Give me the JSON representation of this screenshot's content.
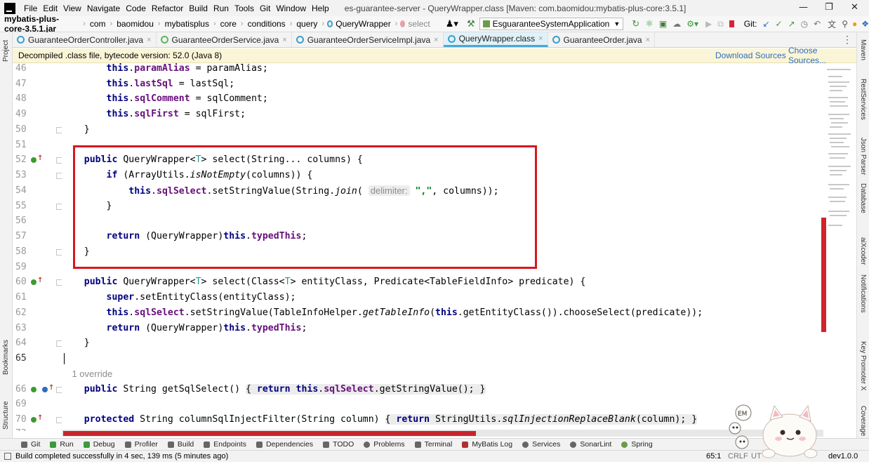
{
  "menubar": {
    "items": [
      "File",
      "Edit",
      "View",
      "Navigate",
      "Code",
      "Refactor",
      "Build",
      "Run",
      "Tools",
      "Git",
      "Window",
      "Help"
    ],
    "window_title": "es-guarantee-server - QueryWrapper.class [Maven: com.baomidou:mybatis-plus-core:3.5.1]"
  },
  "navbar": {
    "crumbs": [
      "mybatis-plus-core-3.5.1.jar",
      "com",
      "baomidou",
      "mybatisplus",
      "core",
      "conditions",
      "query",
      "QueryWrapper",
      "select"
    ],
    "run_config": "EsguaranteeSystemApplication",
    "git_label": "Git:"
  },
  "tabs": [
    {
      "label": "GuaranteeOrderController.java"
    },
    {
      "label": "GuaranteeOrderService.java"
    },
    {
      "label": "GuaranteeOrderServiceImpl.java"
    },
    {
      "label": "QueryWrapper.class"
    },
    {
      "label": "GuaranteeOrder.java"
    }
  ],
  "banner": {
    "text": "Decompiled .class file, bytecode version: 52.0 (Java 8)",
    "download_sources": "Download Sources",
    "choose_sources": "Choose Sources..."
  },
  "left_tools": [
    "Project",
    "Bookmarks",
    "Structure"
  ],
  "right_tools": [
    "Maven",
    "RestServices",
    "Json Parser",
    "Database",
    "aiXcoder",
    "Notifications",
    "Key Promoter X",
    "Coverage"
  ],
  "code": {
    "line_numbers": [
      "46",
      "47",
      "48",
      "49",
      "50",
      "51",
      "52",
      "53",
      "54",
      "55",
      "56",
      "57",
      "58",
      "59",
      "60",
      "61",
      "62",
      "63",
      "64",
      "65",
      "",
      "66",
      "69",
      "70",
      "73"
    ],
    "override_hint": "1 override",
    "param_hint": "delimiter:"
  },
  "bottom_tools": [
    "Git",
    "Run",
    "Debug",
    "Profiler",
    "Build",
    "Endpoints",
    "Dependencies",
    "TODO",
    "Problems",
    "Terminal",
    "MyBatis Log",
    "Services",
    "SonarLint",
    "Spring"
  ],
  "status": {
    "message": "Build completed successfully in 4 sec, 139 ms (5 minutes ago)",
    "position": "65:1",
    "line_sep": "CRLF",
    "encoding": "UT",
    "branch": "dev1.0.0"
  }
}
